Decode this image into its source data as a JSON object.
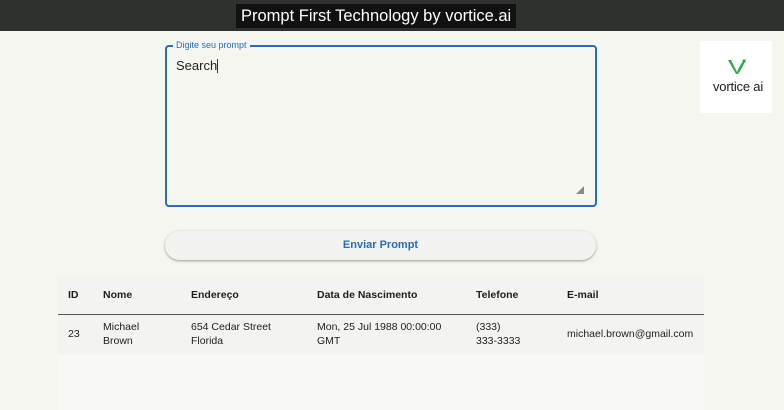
{
  "video_caption": "Prompt First Technology by vortice.ai",
  "prompt": {
    "legend": "Digite seu prompt",
    "value": "Search ",
    "placeholder": ""
  },
  "send_button_label": "Enviar Prompt",
  "logo": {
    "text": "vortice ai",
    "icon": "v-leaf-logo-icon",
    "color": "#2ba84a"
  },
  "table": {
    "headers": {
      "id": "ID",
      "nome": "Nome",
      "endereco": "Endereço",
      "data_nascimento": "Data de Nascimento",
      "telefone": "Telefone",
      "email": "E-mail"
    },
    "rows": [
      {
        "id": "23",
        "nome_line1": "Michael",
        "nome_line2": "Brown",
        "endereco_line1": "654 Cedar Street",
        "endereco_line2": "Florida",
        "data_line1": "Mon, 25 Jul 1988 00:00:00",
        "data_line2": "GMT",
        "telefone_line1": "(333)",
        "telefone_line2": "333-3333",
        "email": "michael.brown@gmail.com"
      }
    ]
  },
  "colors": {
    "accent": "#2a6db5",
    "top_bar": "#2f312f",
    "background": "#f6f6f1"
  }
}
